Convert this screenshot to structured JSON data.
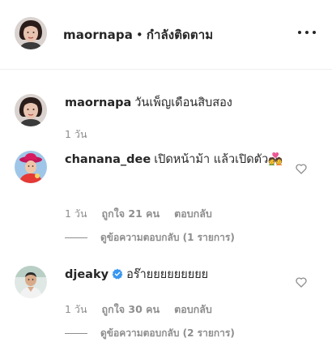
{
  "header": {
    "username": "maornapa",
    "separator": "•",
    "follow_status": "กำลังติดตาม"
  },
  "caption": {
    "username": "maornapa",
    "text": "วันเพ็ญเดือนสิบสอง",
    "time": "1 วัน"
  },
  "comments": [
    {
      "username": "chanana_dee",
      "text": "เปิดหน้าม้า แล้วเปิดตัว💑",
      "time": "1 วัน",
      "likes": "ถูกใจ 21 คน",
      "reply_label": "ตอบกลับ",
      "view_replies": "ดูข้อความตอบกลับ (1 รายการ)"
    },
    {
      "username": "djeaky",
      "verified": true,
      "text": "อร๊ายยยยยยยยย",
      "time": "1 วัน",
      "likes": "ถูกใจ 30 คน",
      "reply_label": "ตอบกลับ",
      "view_replies": "ดูข้อความตอบกลับ (2 รายการ)"
    }
  ],
  "icons": {
    "more": "more-horizontal-icon",
    "like": "heart-outline-icon",
    "verified": "verified-badge-icon"
  },
  "colors": {
    "text": "#262626",
    "secondary": "#8e8e8e",
    "verified": "#3897f0",
    "divider": "#efefef"
  }
}
